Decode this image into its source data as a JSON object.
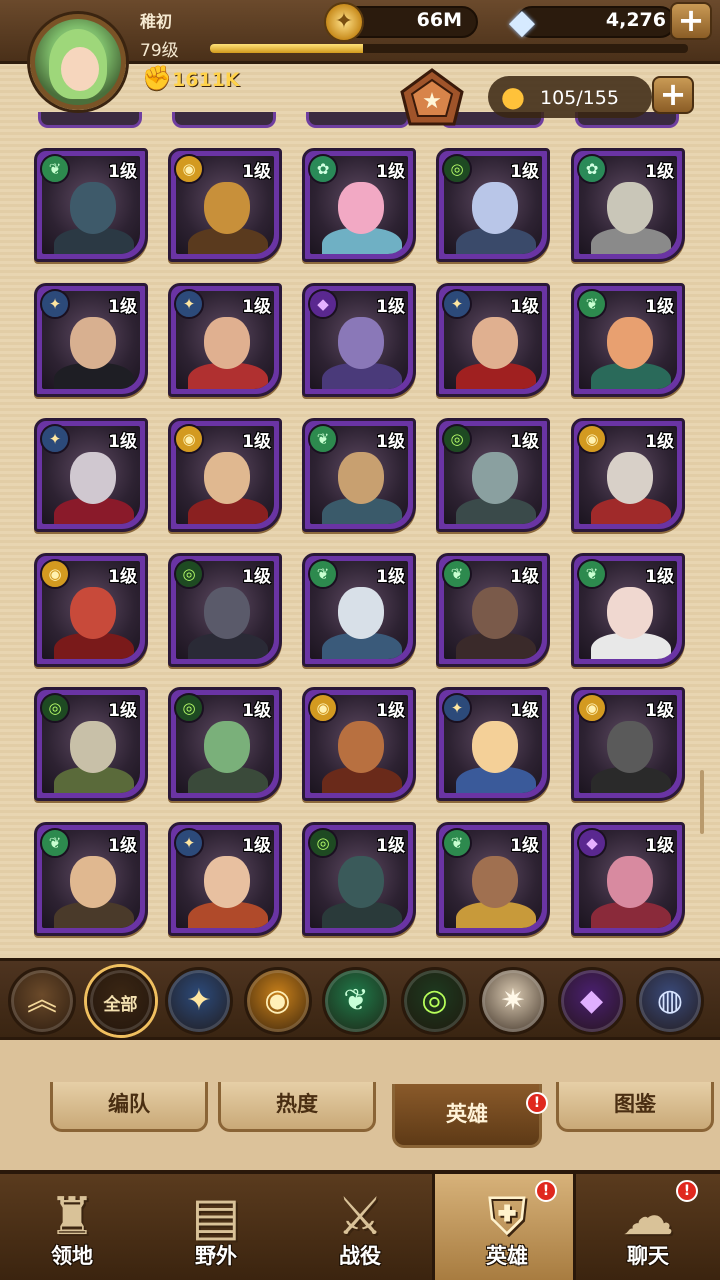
{
  "player": {
    "name": "稚初",
    "level": "79级",
    "power": "1611K",
    "xp_progress": 0.32
  },
  "currency": {
    "gold": "66M",
    "gems": "4,276"
  },
  "roster": {
    "count": "105/155"
  },
  "heroes": [
    {
      "faction": "wilder",
      "level": "1级",
      "skin": "#3e5a6a",
      "cloth": "#2b3944"
    },
    {
      "faction": "mauler",
      "level": "1级",
      "skin": "#c8903a",
      "cloth": "#5a3a1e"
    },
    {
      "faction": "lightbearer",
      "level": "1级",
      "skin": "#f2a9c4",
      "cloth": "#6fb0c4"
    },
    {
      "faction": "graveborn",
      "level": "1级",
      "skin": "#b9c6e8",
      "cloth": "#3a4a6a"
    },
    {
      "faction": "lightbearer",
      "level": "1级",
      "skin": "#c9c6b8",
      "cloth": "#8a8a8a"
    },
    {
      "faction": "lightbearer_star",
      "level": "1级",
      "skin": "#d8b090",
      "cloth": "#1e1e24"
    },
    {
      "faction": "lightbearer_star",
      "level": "1级",
      "skin": "#e0b090",
      "cloth": "#b03030"
    },
    {
      "faction": "hypogean",
      "level": "1级",
      "skin": "#8a78b8",
      "cloth": "#4a3a7a"
    },
    {
      "faction": "lightbearer_star",
      "level": "1级",
      "skin": "#e0b090",
      "cloth": "#a02020"
    },
    {
      "faction": "wilder",
      "level": "1级",
      "skin": "#e8a070",
      "cloth": "#2a6a5a"
    },
    {
      "faction": "lightbearer_star",
      "level": "1级",
      "skin": "#d0c8d0",
      "cloth": "#8a1a2a"
    },
    {
      "faction": "mauler",
      "level": "1级",
      "skin": "#e0b890",
      "cloth": "#8a2020"
    },
    {
      "faction": "wilder",
      "level": "1级",
      "skin": "#c8a070",
      "cloth": "#3a5a6a"
    },
    {
      "faction": "graveborn",
      "level": "1级",
      "skin": "#8aa0a0",
      "cloth": "#3a4a4a"
    },
    {
      "faction": "mauler",
      "level": "1级",
      "skin": "#d8d0c8",
      "cloth": "#a02a2a"
    },
    {
      "faction": "mauler",
      "level": "1级",
      "skin": "#c84a3a",
      "cloth": "#7a1a1a"
    },
    {
      "faction": "graveborn",
      "level": "1级",
      "skin": "#5a5a6a",
      "cloth": "#2a2a36"
    },
    {
      "faction": "wilder",
      "level": "1级",
      "skin": "#d8e0e8",
      "cloth": "#3a5a7a"
    },
    {
      "faction": "wilder",
      "level": "1级",
      "skin": "#7a5a4a",
      "cloth": "#3a2a2a"
    },
    {
      "faction": "wilder",
      "level": "1级",
      "skin": "#f0d8d0",
      "cloth": "#e8e8e8"
    },
    {
      "faction": "graveborn",
      "level": "1级",
      "skin": "#c8c0a8",
      "cloth": "#5a6a3a"
    },
    {
      "faction": "graveborn",
      "level": "1级",
      "skin": "#7ab07a",
      "cloth": "#3a4a3a"
    },
    {
      "faction": "mauler",
      "level": "1级",
      "skin": "#b87040",
      "cloth": "#6a2a1a"
    },
    {
      "faction": "lightbearer_star",
      "level": "1级",
      "skin": "#f4d098",
      "cloth": "#3a5a9a"
    },
    {
      "faction": "mauler",
      "level": "1级",
      "skin": "#5a5a5a",
      "cloth": "#2a2a2a"
    },
    {
      "faction": "wilder",
      "level": "1级",
      "skin": "#e0b890",
      "cloth": "#4a3a2a"
    },
    {
      "faction": "lightbearer_star",
      "level": "1级",
      "skin": "#e8c0a0",
      "cloth": "#b04a2a"
    },
    {
      "faction": "graveborn",
      "level": "1级",
      "skin": "#3a5a5a",
      "cloth": "#2a3a3a"
    },
    {
      "faction": "wilder",
      "level": "1级",
      "skin": "#a07050",
      "cloth": "#c89a3a"
    },
    {
      "faction": "hypogean",
      "level": "1级",
      "skin": "#d88aa0",
      "cloth": "#8a2a3a"
    }
  ],
  "filters": [
    {
      "id": "collapse",
      "label": "",
      "icon": "chevron-up-icon",
      "bg": "#6b4a2a"
    },
    {
      "id": "all",
      "label": "全部",
      "icon": "",
      "bg": "#3a2614",
      "selected": true
    },
    {
      "id": "lightbearer",
      "label": "",
      "icon": "star-icon",
      "bg": "#2c4a7a"
    },
    {
      "id": "mauler",
      "label": "",
      "icon": "mauler-icon",
      "bg": "#c8801a"
    },
    {
      "id": "wilder",
      "label": "",
      "icon": "leaf-icon",
      "bg": "#1f7a4a"
    },
    {
      "id": "graveborn",
      "label": "",
      "icon": "eye-icon",
      "bg": "#1e3a20"
    },
    {
      "id": "celestial",
      "label": "",
      "icon": "sun-icon",
      "bg": "#d8c8b0"
    },
    {
      "id": "hypogean",
      "label": "",
      "icon": "hypogean-icon",
      "bg": "#4a2070"
    },
    {
      "id": "dimensional",
      "label": "",
      "icon": "dimensional-icon",
      "bg": "#3a4a7a"
    }
  ],
  "sub_tabs": [
    {
      "label": "编队",
      "active": false
    },
    {
      "label": "热度",
      "active": false
    },
    {
      "label": "英雄",
      "active": true,
      "alert": "!"
    },
    {
      "label": "图鉴",
      "active": false
    }
  ],
  "nav": [
    {
      "label": "领地",
      "icon": "castle-icon",
      "active": false
    },
    {
      "label": "野外",
      "icon": "map-icon",
      "active": false
    },
    {
      "label": "战役",
      "icon": "sword-icon",
      "active": false
    },
    {
      "label": "英雄",
      "icon": "helmet-icon",
      "active": true,
      "alert": "!"
    },
    {
      "label": "聊天",
      "icon": "chat-icon",
      "active": false,
      "alert": "!"
    }
  ]
}
